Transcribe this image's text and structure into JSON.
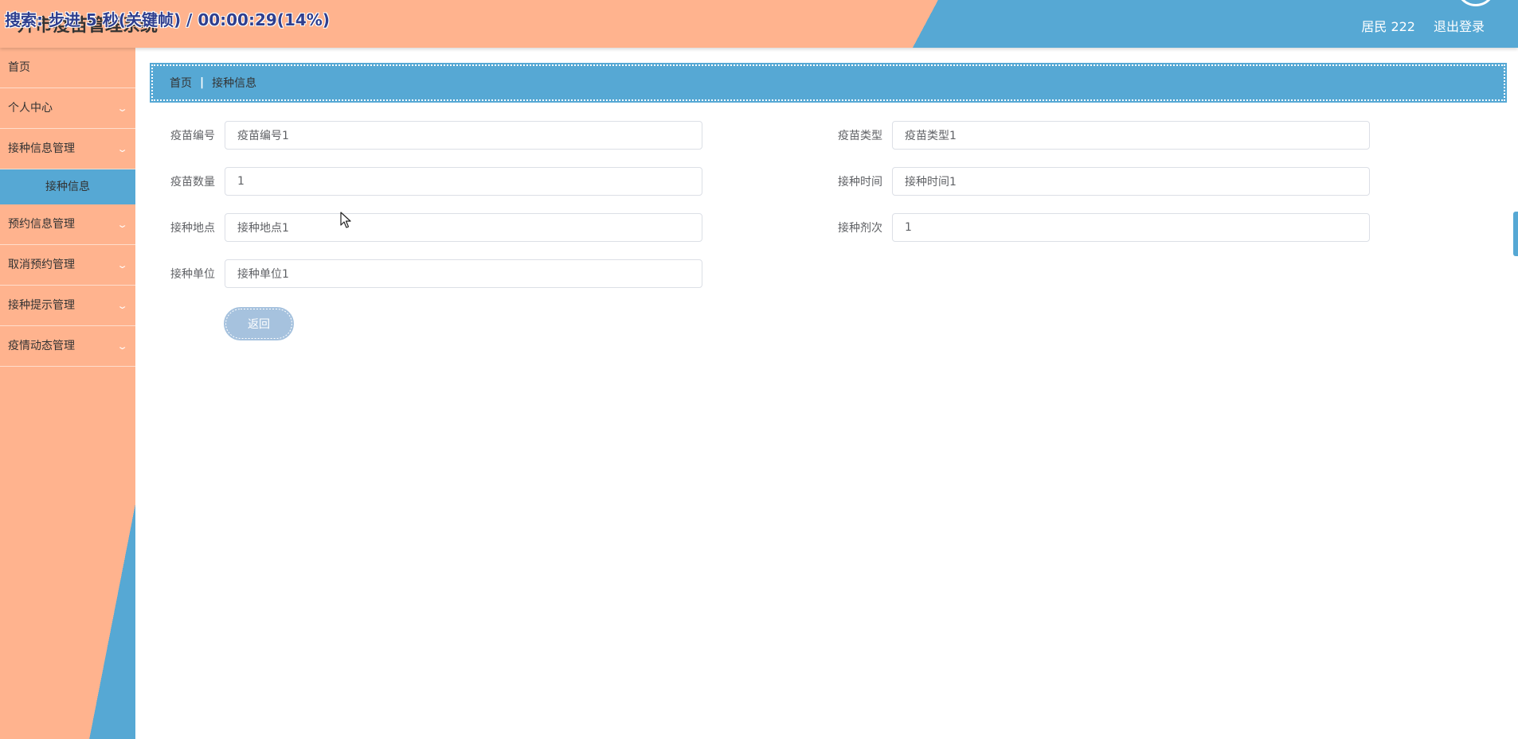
{
  "header": {
    "title": "升市疫苗管理系统",
    "overlay": "搜索: 步进 5 秒(关键帧) / 00:00:29(14%)",
    "user": "居民 222",
    "logout": "退出登录"
  },
  "sidebar": {
    "items": [
      {
        "label": "首页"
      },
      {
        "label": "个人中心"
      },
      {
        "label": "接种信息管理"
      },
      {
        "label": "预约信息管理"
      },
      {
        "label": "取消预约管理"
      },
      {
        "label": "接种提示管理"
      },
      {
        "label": "疫情动态管理"
      }
    ],
    "active_sub": "接种信息"
  },
  "breadcrumb": {
    "home": "首页",
    "current": "接种信息"
  },
  "form": {
    "vaccine_no": {
      "label": "疫苗编号",
      "value": "疫苗编号1"
    },
    "vaccine_type": {
      "label": "疫苗类型",
      "value": "疫苗类型1"
    },
    "vaccine_qty": {
      "label": "疫苗数量",
      "value": "1"
    },
    "vacc_time": {
      "label": "接种时间",
      "value": "接种时间1"
    },
    "vacc_place": {
      "label": "接种地点",
      "value": "接种地点1"
    },
    "vacc_dose": {
      "label": "接种剂次",
      "value": "1"
    },
    "vacc_unit": {
      "label": "接种单位",
      "value": "接种单位1"
    }
  },
  "back_button": "返回"
}
